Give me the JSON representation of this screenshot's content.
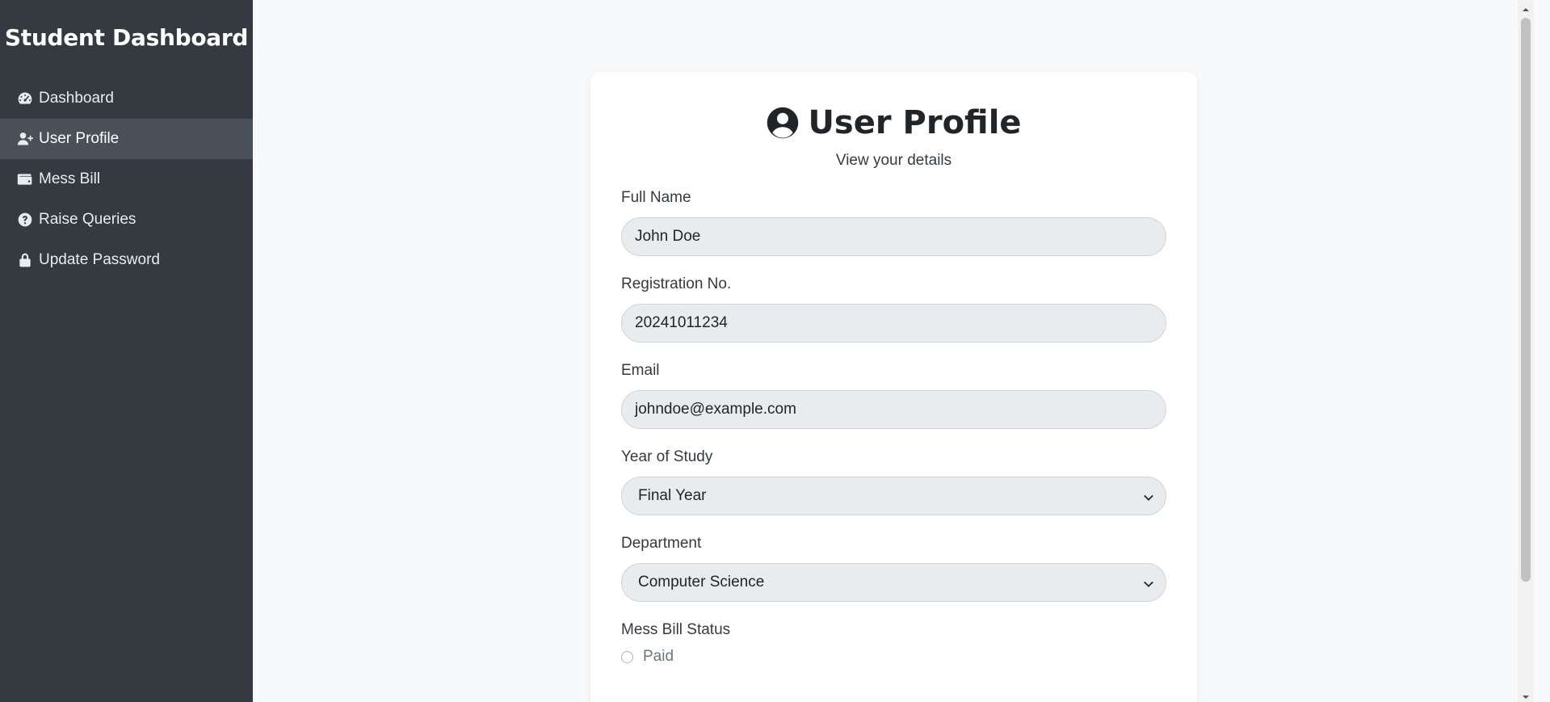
{
  "sidebar": {
    "title": "Student Dashboard",
    "items": [
      {
        "label": "Dashboard",
        "icon": "gauge-icon"
      },
      {
        "label": "User Profile",
        "icon": "user-plus-icon",
        "active": true
      },
      {
        "label": "Mess Bill",
        "icon": "wallet-icon"
      },
      {
        "label": "Raise Queries",
        "icon": "question-circle-icon"
      },
      {
        "label": "Update Password",
        "icon": "lock-icon"
      }
    ]
  },
  "profile": {
    "title": "User Profile",
    "subtitle": "View your details",
    "fields": {
      "full_name": {
        "label": "Full Name",
        "value": "John Doe"
      },
      "registration": {
        "label": "Registration No.",
        "value": "20241011234"
      },
      "email": {
        "label": "Email",
        "value": "johndoe@example.com"
      },
      "year": {
        "label": "Year of Study",
        "value": "Final Year"
      },
      "department": {
        "label": "Department",
        "value": "Computer Science"
      }
    },
    "mess_bill": {
      "label": "Mess Bill Status",
      "options": [
        "Paid"
      ]
    }
  },
  "colors": {
    "sidebar_bg": "#343a40",
    "sidebar_active": "#495057",
    "page_bg": "#f8f9fa",
    "input_bg": "#e9ecef"
  }
}
